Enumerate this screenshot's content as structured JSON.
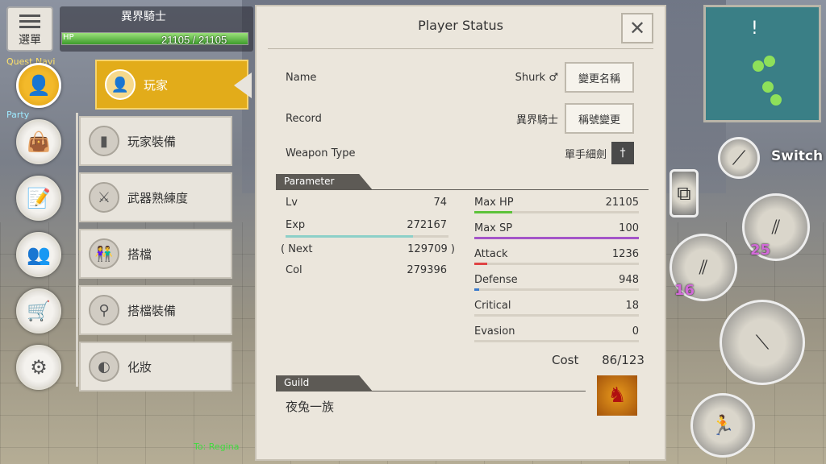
{
  "hud": {
    "menu_label": "選單",
    "player_title": "異界騎士",
    "hp_label": "HP",
    "hp_text": "21105 / 21105",
    "hp_fraction": 1.0,
    "quest_label": "Quest Navi",
    "party_label": "Party",
    "chat_to": "To: Regina"
  },
  "side_menu": {
    "items": [
      {
        "label": "玩家",
        "icon": "person-icon"
      },
      {
        "label": "玩家裝備",
        "icon": "armor-icon"
      },
      {
        "label": "武器熟練度",
        "icon": "crossed-swords-icon"
      },
      {
        "label": "搭檔",
        "icon": "partner-icon"
      },
      {
        "label": "搭檔裝備",
        "icon": "partner-armor-icon"
      },
      {
        "label": "化妝",
        "icon": "mirror-icon"
      }
    ]
  },
  "panel": {
    "title": "Player Status",
    "close_glyph": "✕",
    "name_label": "Name",
    "name_value": "Shurk ♂",
    "rename_button": "變更名稱",
    "record_label": "Record",
    "record_value": "異界騎士",
    "retitle_button": "稱號變更",
    "weapon_type_label": "Weapon Type",
    "weapon_type_value": "單手細劍",
    "parameter_heading": "Parameter",
    "lv_label": "Lv",
    "lv_value": "74",
    "exp_label": "Exp",
    "exp_value": "272167",
    "exp_fraction": 0.78,
    "next_label": "( Next",
    "next_value": "129709 )",
    "col_label": "Col",
    "col_value": "279396",
    "stats": [
      {
        "label": "Max HP",
        "value": "21105",
        "color": "#5cc23a",
        "fraction": 0.23
      },
      {
        "label": "Max SP",
        "value": "100",
        "color": "#a455c8",
        "fraction": 1.0
      },
      {
        "label": "Attack",
        "value": "1236",
        "color": "#e04444",
        "fraction": 0.08
      },
      {
        "label": "Defense",
        "value": "948",
        "color": "#3a7acc",
        "fraction": 0.03
      },
      {
        "label": "Critical",
        "value": "18",
        "color": "#d8b400",
        "fraction": 0.0
      },
      {
        "label": "Evasion",
        "value": "0",
        "color": "#d8b400",
        "fraction": 0.0
      }
    ],
    "cost_label": "Cost",
    "cost_value": "86/123",
    "guild_heading": "Guild",
    "guild_name": "夜兔一族"
  },
  "right_hud": {
    "switch_label": "Switch",
    "skill_count_1": "25",
    "skill_count_2": "16"
  },
  "colors": {
    "accent": "#e2ac1a",
    "panel_bg": "#ebe6dc",
    "heading_bg": "#5d5a55"
  }
}
